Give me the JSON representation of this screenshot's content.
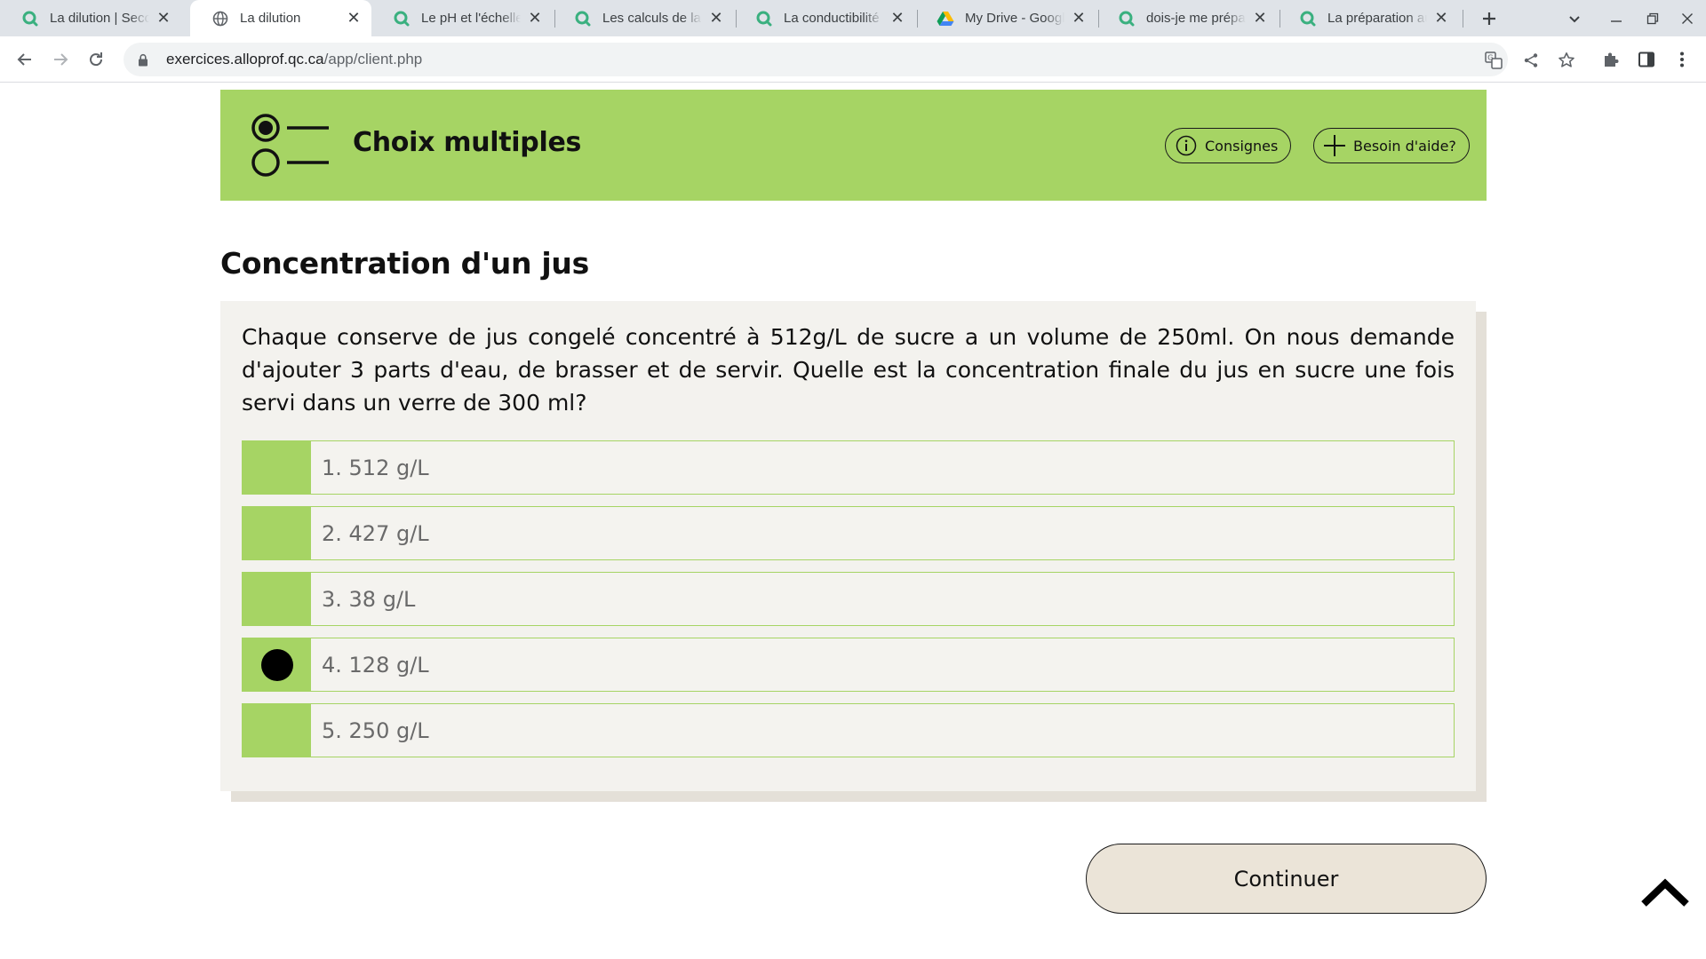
{
  "browser": {
    "tabs": [
      {
        "title": "La dilution | Secondaire | Alloprof",
        "favicon": "alloprof-icon",
        "active": false
      },
      {
        "title": "La dilution",
        "favicon": "globe-icon",
        "active": true
      },
      {
        "title": "Le pH et l'échelle pH | Alloprof",
        "favicon": "alloprof-icon",
        "active": false
      },
      {
        "title": "Les calculs de la concentration",
        "favicon": "alloprof-icon",
        "active": false
      },
      {
        "title": "La conductibilité électrique",
        "favicon": "alloprof-icon",
        "active": false
      },
      {
        "title": "My Drive - Google Drive",
        "favicon": "google-drive-icon",
        "active": false
      },
      {
        "title": "dois-je me préparer",
        "favicon": "alloprof-icon",
        "active": false
      },
      {
        "title": "La préparation aux examens",
        "favicon": "alloprof-icon",
        "active": false
      }
    ],
    "url_domain": "exercices.alloprof.qc.ca",
    "url_path": "/app/client.php"
  },
  "header": {
    "title": "Choix multiples",
    "instructions_label": "Consignes",
    "help_label": "Besoin d'aide?",
    "accent_color": "#a6d464"
  },
  "exercise": {
    "title": "Concentration d'un jus",
    "question": "Chaque conserve de jus congelé concentré à 512g/L de sucre a un volume de 250ml. On nous demande d'ajouter 3 parts d'eau, de brasser et de servir. Quelle est la concentration finale du jus en sucre une fois servi dans un verre de 300 ml?",
    "options": [
      {
        "label": "1. 512 g/L",
        "selected": false
      },
      {
        "label": "2. 427 g/L",
        "selected": false
      },
      {
        "label": "3. 38 g/L",
        "selected": false
      },
      {
        "label": "4. 128 g/L",
        "selected": true
      },
      {
        "label": "5. 250 g/L",
        "selected": false
      }
    ]
  },
  "footer": {
    "continue_label": "Continuer"
  }
}
